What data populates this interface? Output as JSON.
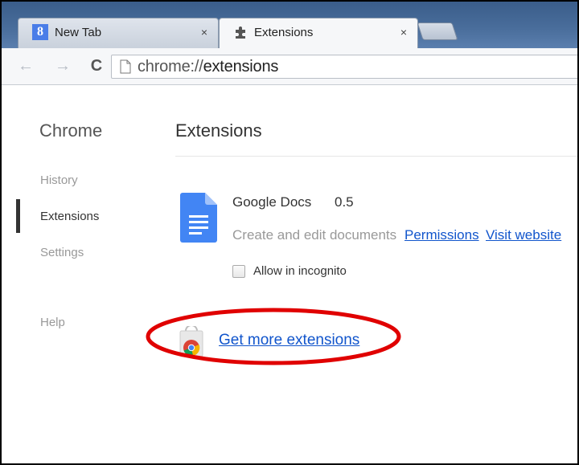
{
  "tabs": [
    {
      "title": "New Tab",
      "close": "×"
    },
    {
      "title": "Extensions",
      "close": "×"
    }
  ],
  "toolbar": {
    "back": "←",
    "forward": "→",
    "reload": "C",
    "url_scheme": "chrome://",
    "url_path": "extensions"
  },
  "sidebar": {
    "title": "Chrome",
    "items": [
      {
        "label": "History"
      },
      {
        "label": "Extensions"
      },
      {
        "label": "Settings"
      },
      {
        "label": "Help"
      }
    ]
  },
  "main": {
    "title": "Extensions",
    "extension": {
      "name": "Google Docs",
      "version": "0.5",
      "description": "Create and edit documents",
      "permissions_link": "Permissions",
      "website_link": "Visit website",
      "incognito_label": "Allow in incognito",
      "incognito_checked": false,
      "icon": "google-docs-icon"
    },
    "get_more_link": "Get more extensions",
    "store_icon": "chrome-web-store-icon"
  },
  "colors": {
    "link": "#1155cc",
    "highlight_ellipse": "#e00000",
    "docs_blue": "#4285f4"
  }
}
